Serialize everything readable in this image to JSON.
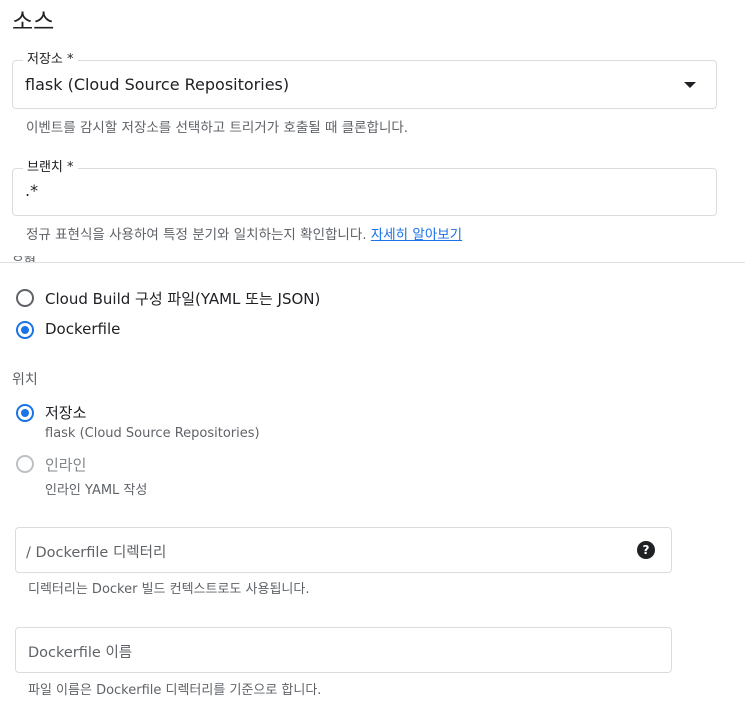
{
  "section": {
    "title": "소스"
  },
  "repository": {
    "label": "저장소 *",
    "value": "flask (Cloud Source Repositories)",
    "helper": "이벤트를 감시할 저장소를 선택하고 트리거가 호출될 때 클론합니다."
  },
  "branch": {
    "label": "브랜치 *",
    "value": ".*",
    "helper": "정규 표현식을 사용하여 특정 분기와 일치하는지 확인합니다.",
    "learn_more": "자세히 알아보기"
  },
  "type": {
    "label": "유형",
    "options": [
      {
        "label": "Cloud Build 구성 파일(YAML 또는 JSON)",
        "checked": false
      },
      {
        "label": "Dockerfile",
        "checked": true
      }
    ]
  },
  "location": {
    "label": "위치",
    "options": [
      {
        "label": "저장소",
        "sub": "flask (Cloud Source Repositories)",
        "checked": true,
        "disabled": false
      },
      {
        "label": "인라인",
        "sub": "인라인 YAML 작성",
        "checked": false,
        "disabled": true
      }
    ]
  },
  "dockerfile_dir": {
    "placeholder": "/ Dockerfile 디렉터리",
    "helper": "디렉터리는 Docker 빌드 컨텍스트로도 사용됩니다.",
    "help_icon": "?"
  },
  "dockerfile_name": {
    "placeholder": "Dockerfile 이름",
    "helper": "파일 이름은 Dockerfile 디렉터리를 기준으로 합니다."
  },
  "colors": {
    "accent": "#1a73e8",
    "text": "#202124",
    "secondary": "#5f6368",
    "border": "#dadce0"
  }
}
